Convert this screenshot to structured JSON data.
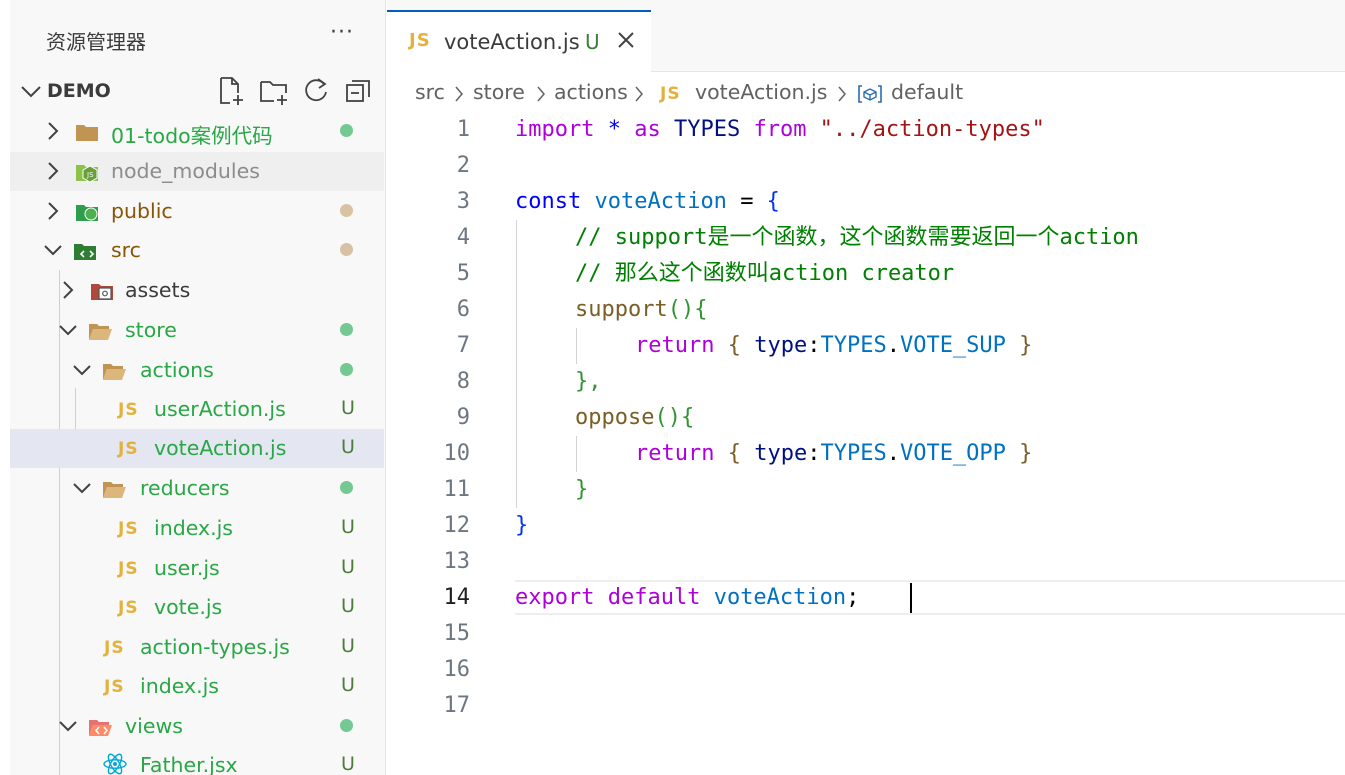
{
  "explorer": {
    "title": "资源管理器",
    "more": "···",
    "folder": "DEMO",
    "items": [
      {
        "label": "01-todo案例代码",
        "badge": "dot",
        "color": "#28a745",
        "badge_color": "#73c991"
      },
      {
        "label": "node_modules",
        "badge": "",
        "color": "#8c8c8c",
        "badge_color": ""
      },
      {
        "label": "public",
        "badge": "dot",
        "color": "#895503",
        "badge_color": "#d8c2a3"
      },
      {
        "label": "src",
        "badge": "dot",
        "color": "#895503",
        "badge_color": "#d8c2a3"
      },
      {
        "label": "assets",
        "badge": "",
        "color": "#3b3b3b",
        "badge_color": ""
      },
      {
        "label": "store",
        "badge": "dot",
        "color": "#28a745",
        "badge_color": "#73c991"
      },
      {
        "label": "actions",
        "badge": "dot",
        "color": "#28a745",
        "badge_color": "#73c991"
      },
      {
        "label": "userAction.js",
        "badge": "U",
        "color": "#28a745"
      },
      {
        "label": "voteAction.js",
        "badge": "U",
        "color": "#28a745"
      },
      {
        "label": "reducers",
        "badge": "dot",
        "color": "#28a745",
        "badge_color": "#73c991"
      },
      {
        "label": "index.js",
        "badge": "U",
        "color": "#28a745"
      },
      {
        "label": "user.js",
        "badge": "U",
        "color": "#28a745"
      },
      {
        "label": "vote.js",
        "badge": "U",
        "color": "#28a745"
      },
      {
        "label": "action-types.js",
        "badge": "U",
        "color": "#28a745"
      },
      {
        "label": "index.js",
        "badge": "U",
        "color": "#28a745"
      },
      {
        "label": "views",
        "badge": "dot",
        "color": "#28a745",
        "badge_color": "#73c991"
      },
      {
        "label": "Father.jsx",
        "badge": "U",
        "color": "#28a745"
      }
    ],
    "js_label": "JS",
    "u_label": "U"
  },
  "tab": {
    "icon": "JS",
    "title": "voteAction.js",
    "modified": "U"
  },
  "breadcrumbs": [
    "src",
    "store",
    "actions",
    "voteAction.js",
    "default"
  ],
  "breadcrumb_js": "JS",
  "editor": {
    "line_numbers": [
      "1",
      "2",
      "3",
      "4",
      "5",
      "6",
      "7",
      "8",
      "9",
      "10",
      "11",
      "12",
      "13",
      "14",
      "15",
      "16",
      "17"
    ],
    "active_line": "14",
    "lines": {
      "l1": {
        "a": "import",
        "b": " * ",
        "c": "as",
        "d": " TYPES ",
        "e": "from",
        "f": " \"../action-types\""
      },
      "l3": {
        "a": "const",
        "b": " voteAction ",
        "c": "=",
        "d": " {"
      },
      "l4": "// support是一个函数，这个函数需要返回一个action",
      "l5": "// 那么这个函数叫action creator",
      "l6": {
        "a": "support",
        "b": "(){"
      },
      "l7": {
        "a": "return",
        "b": " { ",
        "c": "type",
        "d": ":",
        "e": "TYPES",
        "f": ".",
        "g": "VOTE_SUP",
        "h": " }"
      },
      "l8": "},",
      "l9": {
        "a": "oppose",
        "b": "(){"
      },
      "l10": {
        "a": "return",
        "b": " { ",
        "c": "type",
        "d": ":",
        "e": "TYPES",
        "f": ".",
        "g": "VOTE_OPP",
        "h": " }"
      },
      "l11": "}",
      "l12": "}",
      "l14": {
        "a": "export",
        "b": " ",
        "c": "default",
        "d": " voteAction",
        "e": ";"
      }
    }
  }
}
